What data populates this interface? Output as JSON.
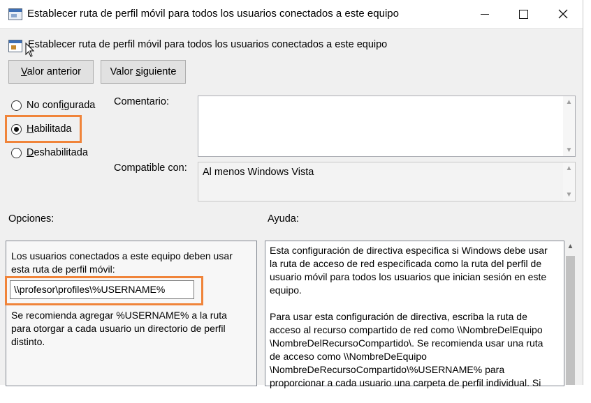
{
  "window": {
    "title": "Establecer ruta de perfil móvil para todos los usuarios conectados a este equipo",
    "icons": {
      "app": "policy-icon",
      "minimize": "minimize-icon",
      "maximize": "maximize-icon",
      "close": "close-icon"
    }
  },
  "header": {
    "policy_name": "Establecer ruta de perfil móvil para todos los usuarios conectados a este equipo"
  },
  "nav": {
    "prev_label_pre": "",
    "prev_label_u": "V",
    "prev_label_post": "alor anterior",
    "next_label_pre": "Valor ",
    "next_label_u": "s",
    "next_label_post": "iguiente"
  },
  "state": {
    "options": [
      {
        "pre": "No conf",
        "u": "i",
        "post": "gurada",
        "selected": false
      },
      {
        "pre": "",
        "u": "H",
        "post": "abilitada",
        "selected": true
      },
      {
        "pre": "",
        "u": "D",
        "post": "eshabilitada",
        "selected": false
      }
    ]
  },
  "comment": {
    "label": "Comentario:",
    "value": ""
  },
  "compat": {
    "label": "Compatible con:",
    "value": "Al menos Windows Vista"
  },
  "options_panel": {
    "label": "Opciones:",
    "intro": "Los usuarios conectados a este equipo deben usar esta ruta de perfil móvil:",
    "path_value": "\\\\profesor\\profiles\\%USERNAME%",
    "note": "Se recomienda agregar %USERNAME% a la ruta para otorgar a cada usuario un directorio de perfil distinto."
  },
  "help_panel": {
    "label": "Ayuda:",
    "paragraphs": [
      "Esta configuración de directiva especifica si Windows debe usar la ruta de acceso de red especificada como la ruta del perfil de usuario móvil para todos los usuarios que inician sesión en este equipo.",
      "Para usar esta configuración de directiva, escriba la ruta de acceso al recurso compartido de red como \\\\NombreDelEquipo \\NombreDelRecursoCompartido\\. Se recomienda usar una ruta de acceso como \\\\NombreDeEquipo \\NombreDeRecursoCompartido\\%USERNAME% para proporcionar a cada usuario una carpeta de perfil individual. Si"
    ]
  },
  "colors": {
    "highlight": "#f0843a",
    "window_bg": "#f0f0f0"
  }
}
